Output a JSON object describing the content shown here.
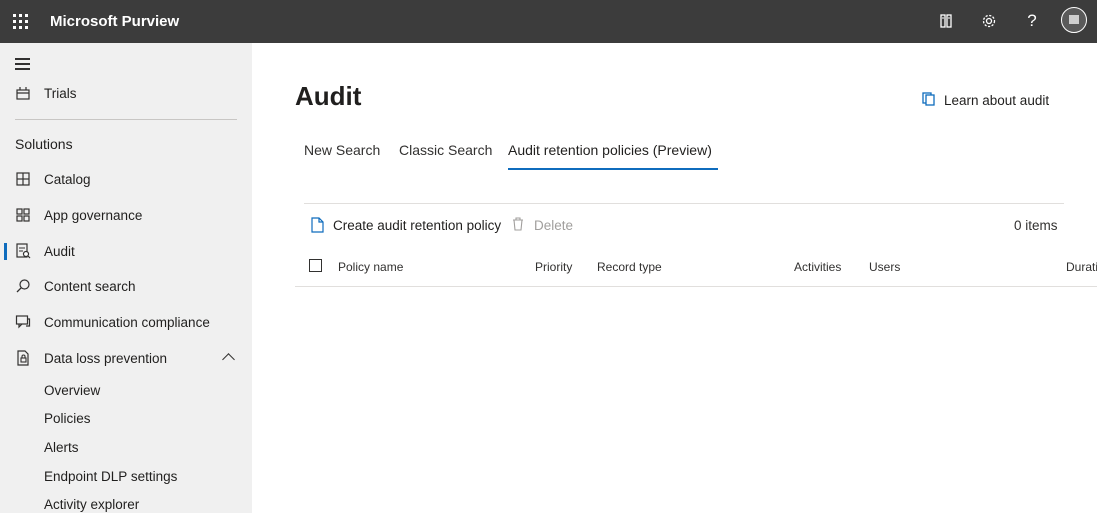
{
  "app": {
    "title": "Microsoft Purview"
  },
  "topbar_icons": [
    "waffle-icon",
    "reader-icon",
    "gear-icon",
    "help-icon",
    "avatar"
  ],
  "sidebar": {
    "top_items": [
      {
        "label": "Trials",
        "icon": "trials-icon"
      }
    ],
    "section_title": "Solutions",
    "items": [
      {
        "label": "Catalog",
        "icon": "catalog-icon"
      },
      {
        "label": "App governance",
        "icon": "app-governance-icon"
      },
      {
        "label": "Audit",
        "icon": "audit-icon",
        "active": true
      },
      {
        "label": "Content search",
        "icon": "search-icon"
      },
      {
        "label": "Communication compliance",
        "icon": "chat-icon"
      },
      {
        "label": "Data loss prevention",
        "icon": "dlp-icon",
        "expanded": true
      }
    ],
    "dlp_sub_items": [
      "Overview",
      "Policies",
      "Alerts",
      "Endpoint DLP settings",
      "Activity explorer"
    ]
  },
  "main": {
    "title": "Audit",
    "learn_link": "Learn about audit",
    "tabs": [
      {
        "label": "New Search"
      },
      {
        "label": "Classic Search"
      },
      {
        "label": "Audit retention policies (Preview)",
        "active": true
      }
    ],
    "commands": {
      "create": "Create audit retention policy",
      "delete": "Delete"
    },
    "item_count": "0 items",
    "columns": [
      "Policy name",
      "Priority",
      "Record type",
      "Activities",
      "Users",
      "Durati"
    ]
  },
  "colors": {
    "topbar": "#3c3c3c",
    "sidebar": "#f0f0f0",
    "accent": "#0f6cbd"
  }
}
